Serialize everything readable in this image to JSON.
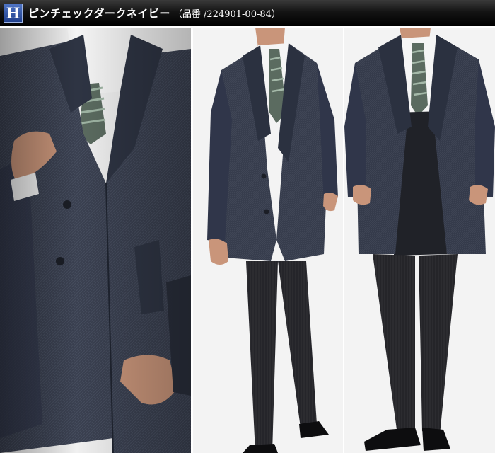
{
  "header": {
    "badge_letter": "H",
    "title": "ピンチェックダークネイビー",
    "item_number": "（品番 /224901-00-84）"
  },
  "colors": {
    "header_bg": "#0a0a0a",
    "badge_blue": "#2f54a8",
    "coat_navy": "#33394a",
    "suit_dark": "#26262b",
    "shirt": "#f4f4f4",
    "tie_stripe": "#6e8a73",
    "skin": "#c9957a",
    "studio_bg": "#f2f2f2"
  },
  "panels": [
    {
      "name": "closeup-front",
      "view": "close-up of coat front with hand at lapel"
    },
    {
      "name": "full-body-angled",
      "view": "full length, coat open, hand in pocket"
    },
    {
      "name": "full-body-front",
      "view": "full length front, hands in pockets"
    }
  ]
}
